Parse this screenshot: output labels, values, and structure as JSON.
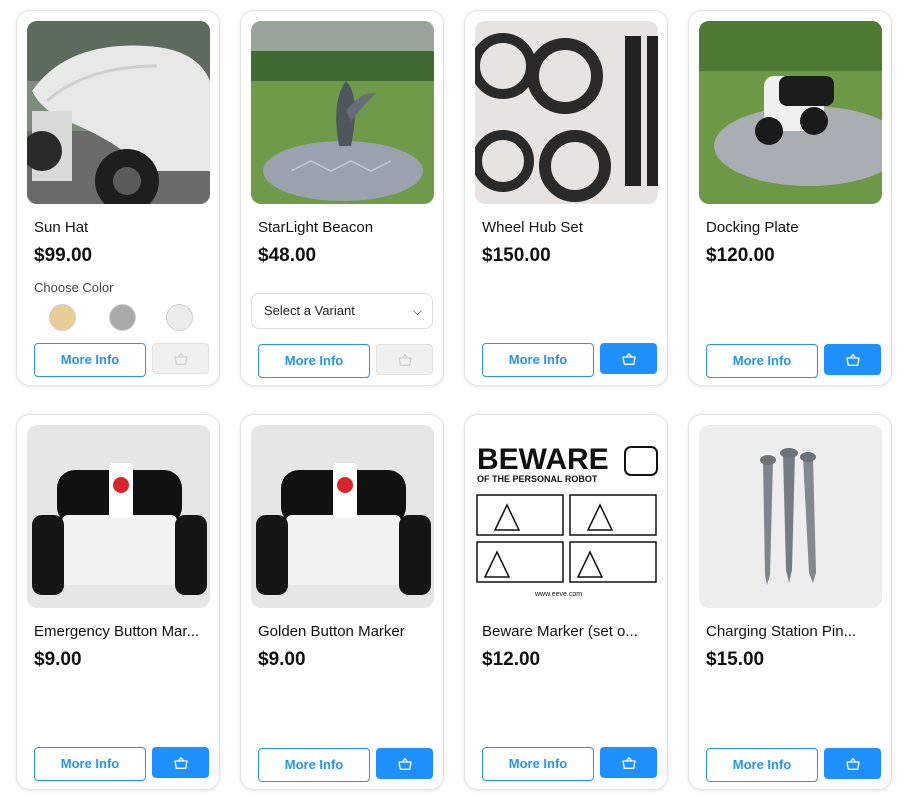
{
  "products": [
    {
      "name": "Sun Hat",
      "price": "$99.00",
      "image": "sun-hat-robot-photo"
    },
    {
      "name": "StarLight Beacon",
      "price": "$48.00",
      "image": "starlight-beacon-photo"
    },
    {
      "name": "Wheel Hub Set",
      "price": "$150.00",
      "image": "wheel-hub-set-photo"
    },
    {
      "name": "Docking Plate",
      "price": "$120.00",
      "image": "docking-plate-photo"
    },
    {
      "name": "Emergency Button Mar...",
      "price": "$9.00",
      "image": "emergency-button-robot-photo"
    },
    {
      "name": "Golden Button Marker",
      "price": "$9.00",
      "image": "golden-button-robot-photo"
    },
    {
      "name": "Beware Marker (set o...",
      "price": "$12.00",
      "image": "beware-marker-sign-photo"
    },
    {
      "name": "Charging Station Pin...",
      "price": "$15.00",
      "image": "charging-station-pins-photo"
    }
  ],
  "labels": {
    "more_info": "More Info",
    "choose_color": "Choose Color",
    "select_variant": "Select a Variant"
  },
  "swatches": [
    {
      "name": "tan",
      "color": "#e9cd98"
    },
    {
      "name": "gray",
      "color": "#a9a9a9"
    },
    {
      "name": "white",
      "color": "#ececec"
    }
  ],
  "sign": {
    "headline": "BEWARE",
    "subline": "OF THE PERSONAL ROBOT",
    "url": "www.eeve.com"
  },
  "colors": {
    "accent": "#1e90ff",
    "disabled": "#f0f0f0"
  },
  "icons": {
    "cart": "basket-icon",
    "dropdown": "chevron-down-icon"
  }
}
